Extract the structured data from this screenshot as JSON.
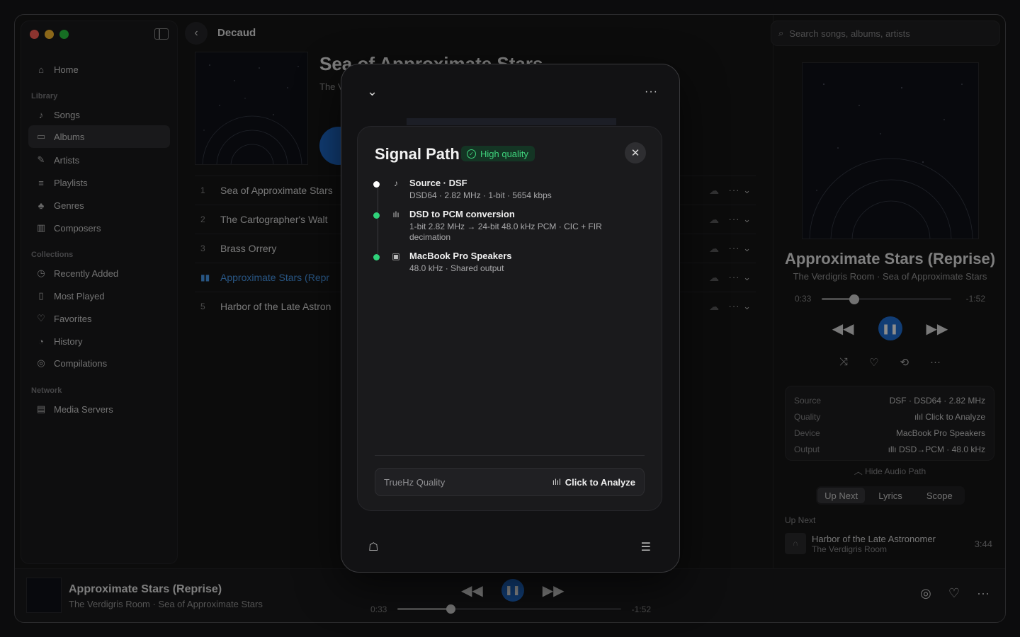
{
  "window": {
    "traffic_colors": [
      "#ff5f57",
      "#febc2e",
      "#28c840"
    ]
  },
  "sidebar": {
    "items_top": [
      {
        "label": "Home",
        "icon": "house-icon"
      }
    ],
    "library_header": "Library",
    "library": [
      {
        "label": "Songs",
        "icon": "note-icon"
      },
      {
        "label": "Albums",
        "icon": "album-icon",
        "active": true
      },
      {
        "label": "Artists",
        "icon": "mic-icon"
      },
      {
        "label": "Playlists",
        "icon": "playlist-icon"
      },
      {
        "label": "Genres",
        "icon": "genres-icon"
      },
      {
        "label": "Composers",
        "icon": "piano-icon"
      }
    ],
    "collections_header": "Collections",
    "collections": [
      {
        "label": "Recently Added",
        "icon": "clock-plus-icon"
      },
      {
        "label": "Most Played",
        "icon": "bars-icon"
      },
      {
        "label": "Favorites",
        "icon": "heart-icon"
      },
      {
        "label": "History",
        "icon": "history-icon"
      },
      {
        "label": "Compilations",
        "icon": "stack-icon"
      }
    ],
    "network_header": "Network",
    "network": [
      {
        "label": "Media Servers",
        "icon": "server-icon"
      }
    ]
  },
  "main": {
    "breadcrumb": "Decaud",
    "album_title": "Sea of Approximate Stars",
    "album_artist": "The V",
    "tracks": [
      {
        "num": "1",
        "title": "Sea of Approximate Stars"
      },
      {
        "num": "2",
        "title": "The Cartographer's Walt"
      },
      {
        "num": "3",
        "title": "Brass Orrery"
      },
      {
        "num": "",
        "title": "Approximate Stars (Repr",
        "playing": true
      },
      {
        "num": "5",
        "title": "Harbor of the Late Astron"
      }
    ]
  },
  "right": {
    "search_placeholder": "Search songs, albums, artists",
    "np_title": "Approximate Stars (Reprise)",
    "np_sub": "The Verdigris Room · Sea of Approximate Stars",
    "elapsed": "0:33",
    "remaining": "-1:52",
    "progress": 0.25,
    "info": [
      {
        "k": "Source",
        "v": "DSF · DSD64 · 2.82 MHz"
      },
      {
        "k": "Quality",
        "v": "Click to Analyze"
      },
      {
        "k": "Device",
        "v": "MacBook Pro Speakers"
      },
      {
        "k": "Output",
        "v": "DSD→PCM · 48.0 kHz"
      }
    ],
    "hide_path": "Hide Audio Path",
    "tabs": [
      "Up Next",
      "Lyrics",
      "Scope"
    ],
    "upnext_header": "Up Next",
    "upnext": {
      "title": "Harbor of the Late Astronomer",
      "artist": "The Verdigris Room",
      "duration": "3:44"
    }
  },
  "player": {
    "title": "Approximate Stars (Reprise)",
    "sub": "The Verdigris Room · Sea of Approximate Stars",
    "elapsed": "0:33",
    "remaining": "-1:52",
    "progress": 0.24
  },
  "signal_panel": {
    "title": "Signal Path",
    "badge": "High quality",
    "steps": [
      {
        "title": "Source · DSF",
        "detail": "DSD64 · 2.82 MHz · 1-bit · 5654 kbps",
        "dot": "#ffffff",
        "icon": "note-icon"
      },
      {
        "title": "DSD to PCM conversion",
        "detail": "1-bit 2.82 MHz → 24-bit 48.0 kHz PCM · CIC + FIR decimation",
        "dot": "#2fd27a",
        "icon": "waveform-icon"
      },
      {
        "title": "MacBook Pro Speakers",
        "detail": "48.0 kHz · Shared output",
        "dot": "#2fd27a",
        "icon": "speaker-icon"
      }
    ],
    "truehz_label": "TrueHz Quality",
    "truehz_action": "Click to Analyze"
  }
}
